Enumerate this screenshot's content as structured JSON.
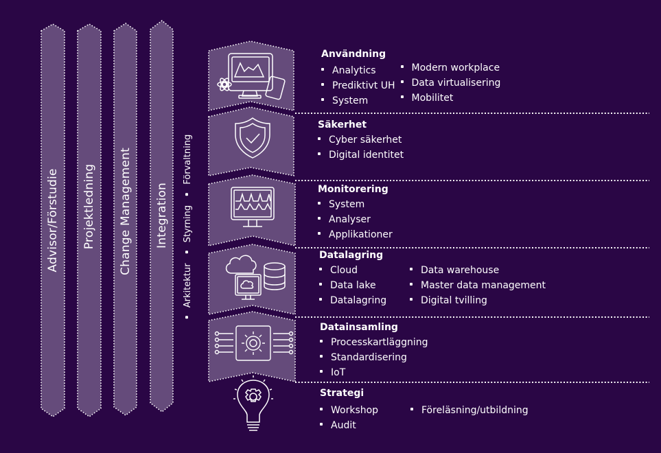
{
  "colors": {
    "background": "#2a0645",
    "panel": "#654b7b",
    "border": "#ffffff",
    "text": "#ffffff"
  },
  "columns": [
    {
      "label": "Advisor/Förstudie"
    },
    {
      "label": "Projektledning"
    },
    {
      "label": "Change Management"
    },
    {
      "label": "Integration"
    }
  ],
  "side_labels": [
    "Arkitektur",
    "Styrning",
    "Förvaltning"
  ],
  "layers": [
    {
      "title": "Användning",
      "icon": "monitor-analytics-icon",
      "columns": [
        [
          "Analytics",
          "Prediktivt UH",
          "System"
        ],
        [
          "Modern workplace",
          "Data virtualisering",
          "Mobilitet"
        ]
      ]
    },
    {
      "title": "Säkerhet",
      "icon": "shield-check-icon",
      "columns": [
        [
          "Cyber säkerhet",
          "Digital identitet"
        ]
      ]
    },
    {
      "title": "Monitorering",
      "icon": "monitor-waveform-icon",
      "columns": [
        [
          "System",
          "Analyser",
          "Applikationer"
        ]
      ]
    },
    {
      "title": "Datalagring",
      "icon": "cloud-database-icon",
      "columns": [
        [
          "Cloud",
          "Data lake",
          "Datalagring"
        ],
        [
          "Data warehouse",
          "Master data management",
          "Digital tvilling"
        ]
      ]
    },
    {
      "title": "Datainsamling",
      "icon": "gear-circuit-icon",
      "columns": [
        [
          "Processkartläggning",
          "Standardisering",
          "IoT"
        ]
      ]
    },
    {
      "title": "Strategi",
      "icon": "lightbulb-gear-icon",
      "columns": [
        [
          "Workshop",
          "Audit"
        ],
        [
          "Föreläsning/utbildning"
        ]
      ]
    }
  ]
}
